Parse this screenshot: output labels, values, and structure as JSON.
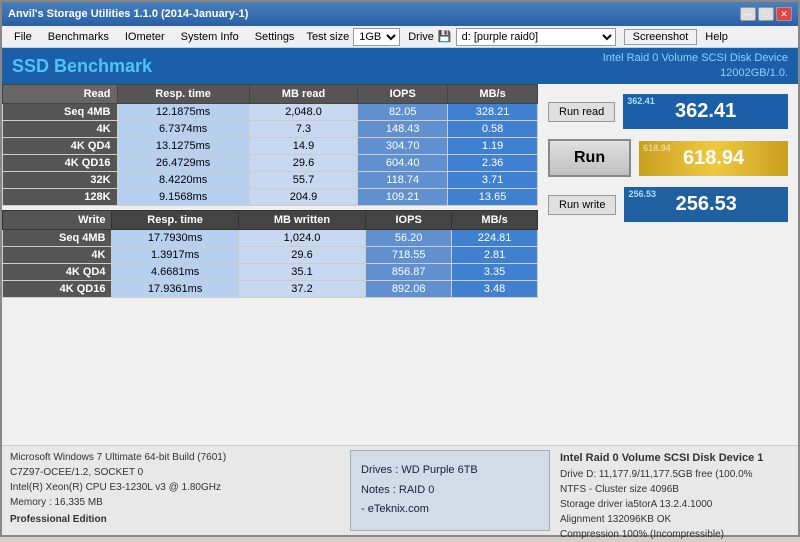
{
  "window": {
    "title": "Anvil's Storage Utilities 1.1.0 (2014-January-1)",
    "buttons": {
      "min": "─",
      "max": "□",
      "close": "✕"
    }
  },
  "menu": {
    "items": [
      "File",
      "Benchmarks",
      "IOmeter",
      "System Info",
      "Settings"
    ],
    "test_size_label": "Test size",
    "test_size_value": "1GB",
    "drive_label": "Drive",
    "drive_icon": "💾",
    "drive_value": "d: [purple raid0]",
    "screenshot_label": "Screenshot",
    "help_label": "Help"
  },
  "header": {
    "title": "SSD Benchmark",
    "device_line1": "Intel Raid 0 Volume SCSI Disk Device",
    "device_line2": "12002GB/1.0."
  },
  "read_table": {
    "headers": [
      "Read",
      "Resp. time",
      "MB read",
      "IOPS",
      "MB/s"
    ],
    "rows": [
      {
        "label": "Seq 4MB",
        "resp": "12.1875ms",
        "mb": "2,048.0",
        "iops": "82.05",
        "mbs": "328.21"
      },
      {
        "label": "4K",
        "resp": "6.7374ms",
        "mb": "7.3",
        "iops": "148.43",
        "mbs": "0.58"
      },
      {
        "label": "4K QD4",
        "resp": "13.1275ms",
        "mb": "14.9",
        "iops": "304.70",
        "mbs": "1.19"
      },
      {
        "label": "4K QD16",
        "resp": "26.4729ms",
        "mb": "29.6",
        "iops": "604.40",
        "mbs": "2.36"
      },
      {
        "label": "32K",
        "resp": "8.4220ms",
        "mb": "55.7",
        "iops": "118.74",
        "mbs": "3.71"
      },
      {
        "label": "128K",
        "resp": "9.1568ms",
        "mb": "204.9",
        "iops": "109.21",
        "mbs": "13.65"
      }
    ]
  },
  "write_table": {
    "headers": [
      "Write",
      "Resp. time",
      "MB written",
      "IOPS",
      "MB/s"
    ],
    "rows": [
      {
        "label": "Seq 4MB",
        "resp": "17.7930ms",
        "mb": "1,024.0",
        "iops": "56.20",
        "mbs": "224.81"
      },
      {
        "label": "4K",
        "resp": "1.3917ms",
        "mb": "29.6",
        "iops": "718.55",
        "mbs": "2.81"
      },
      {
        "label": "4K QD4",
        "resp": "4.6681ms",
        "mb": "35.1",
        "iops": "856.87",
        "mbs": "3.35"
      },
      {
        "label": "4K QD16",
        "resp": "17.9361ms",
        "mb": "37.2",
        "iops": "892.08",
        "mbs": "3.48"
      }
    ]
  },
  "scores": {
    "run_read_label": "Run read",
    "read_score_label": "362.41",
    "read_score": "362.41",
    "run_label": "Run",
    "total_score_label": "618.94",
    "total_score": "618.94",
    "run_write_label": "Run write",
    "write_score_label": "256.53",
    "write_score": "256.53"
  },
  "bottom": {
    "sys_info": [
      "Microsoft Windows 7 Ultimate  64-bit Build (7601)",
      "C7Z97-OCEE/1.2, SOCKET 0",
      "Intel(R) Xeon(R) CPU E3-1230L v3 @ 1.80GHz",
      "Memory : 16,335 MB"
    ],
    "pro_label": "Professional Edition",
    "drives_line1": "Drives : WD Purple 6TB",
    "drives_line2": "Notes : RAID 0",
    "drives_line3": "- eTeknix.com",
    "device_info": [
      "Intel Raid 0 Volume SCSI Disk Device 1",
      "Drive D: 11,177.9/11,177.5GB free (100.0%",
      "NTFS - Cluster size 4096B",
      "Storage driver  ia5torA 13.2.4.1000",
      "",
      "Alignment 132096KB OK",
      "Compression 100% (Incompressible)"
    ]
  }
}
